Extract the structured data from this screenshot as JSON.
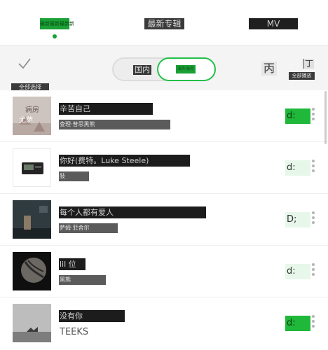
{
  "tabs": [
    {
      "label": "最新最新最新新"
    },
    {
      "label": "最新专辑"
    },
    {
      "label": "MV"
    }
  ],
  "toolbar": {
    "select_all_label": "全部选择",
    "toggle_left": "国内",
    "toggle_right": "海外海外",
    "glyph_a": "丙",
    "glyph_b": "丁",
    "play_all_label": "全部播放"
  },
  "songs": [
    {
      "title": "辛苦自己",
      "artist": "查理·普思黑熊",
      "action": "d:",
      "cover_text_1": "病房",
      "cover_text_2": "尤萨"
    },
    {
      "title": "你好(费特。Luke Steele)",
      "artist": "肢",
      "action": "d:"
    },
    {
      "title": "每个人都有爱人",
      "artist": "萨姆·菲舍尔",
      "action": "D;"
    },
    {
      "title": "lil 位",
      "artist": "黑熊",
      "action": "d:"
    },
    {
      "title": "没有你",
      "artist": "TEEKS",
      "action": "d:"
    }
  ],
  "colors": {
    "accent": "#1fb83a",
    "pale_accent": "#e7f7ea"
  }
}
